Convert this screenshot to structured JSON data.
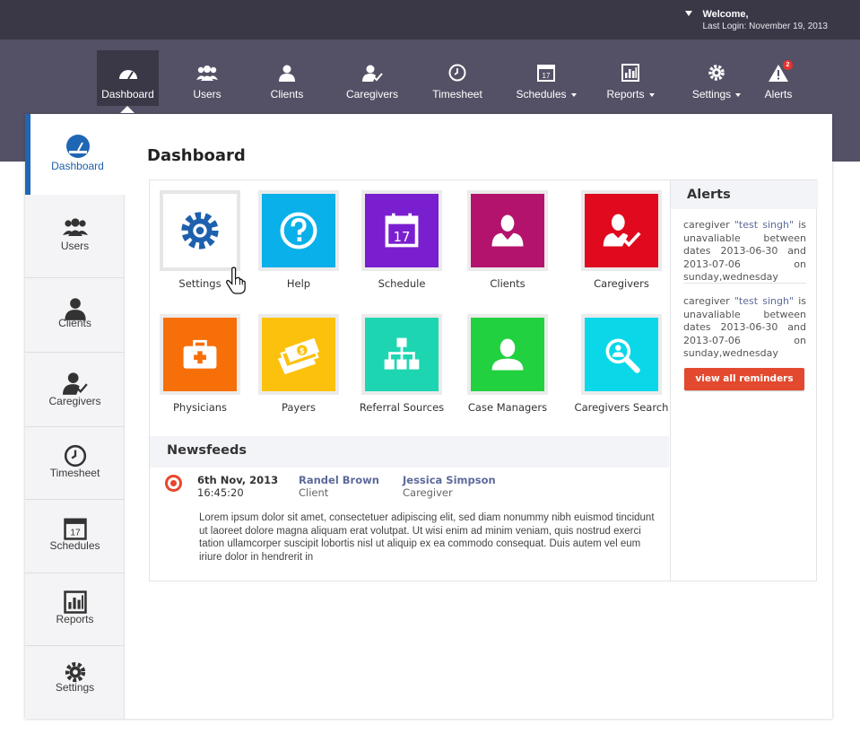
{
  "header": {
    "welcome": "Welcome,",
    "last_login": "Last Login: November 19, 2013"
  },
  "nav": {
    "items": [
      {
        "label": "Dashboard",
        "icon": "gauge-icon"
      },
      {
        "label": "Users",
        "icon": "users-icon"
      },
      {
        "label": "Clients",
        "icon": "client-icon"
      },
      {
        "label": "Caregivers",
        "icon": "caregiver-icon"
      },
      {
        "label": "Timesheet",
        "icon": "clock-icon"
      },
      {
        "label": "Schedules",
        "icon": "calendar-icon"
      },
      {
        "label": "Reports",
        "icon": "bar-chart-icon"
      },
      {
        "label": "Settings",
        "icon": "gear-icon"
      },
      {
        "label": "Alerts",
        "icon": "warning-icon"
      }
    ],
    "alerts_badge": "2"
  },
  "sidebar": {
    "items": [
      {
        "label": "Dashboard"
      },
      {
        "label": "Users"
      },
      {
        "label": "Clients"
      },
      {
        "label": "Caregivers"
      },
      {
        "label": "Timesheet"
      },
      {
        "label": "Schedules"
      },
      {
        "label": "Reports"
      },
      {
        "label": "Settings"
      }
    ]
  },
  "main": {
    "title": "Dashboard",
    "tiles": [
      {
        "label": "Settings",
        "color": "#ffffff"
      },
      {
        "label": "Help",
        "color": "#0ab0ea"
      },
      {
        "label": "Schedule",
        "color": "#7a1fd0"
      },
      {
        "label": "Clients",
        "color": "#b3136d"
      },
      {
        "label": "Caregivers",
        "color": "#e0091d"
      },
      {
        "label": "Physicians",
        "color": "#f76f08"
      },
      {
        "label": "Payers",
        "color": "#fcc10c"
      },
      {
        "label": "Referral Sources",
        "color": "#1dd6b1"
      },
      {
        "label": "Case Managers",
        "color": "#22d13f"
      },
      {
        "label": "Caregivers Search",
        "color": "#0ad8e9"
      }
    ]
  },
  "newsfeeds": {
    "title": "Newsfeeds",
    "entry": {
      "date": "6th Nov, 2013",
      "time": "16:45:20",
      "person1_name": "Randel Brown",
      "person1_role": "Client",
      "person2_name": "Jessica Simpson",
      "person2_role": "Caregiver",
      "body": "Lorem ipsum dolor sit amet, consectetuer adipiscing elit, sed diam nonummy nibh euismod tincidunt ut laoreet dolore magna aliquam erat volutpat. Ut wisi enim ad minim veniam, quis nostrud exerci tation ullamcorper suscipit lobortis nisl ut aliquip ex ea commodo consequat. Duis autem vel eum iriure dolor in hendrerit in"
    }
  },
  "alerts": {
    "title": "Alerts",
    "items": [
      {
        "pre": "caregiver ",
        "name": "\"test singh\"",
        "post": " is unavaliable between dates 2013-06-30 and 2013-07-06 on sunday,wednesday"
      },
      {
        "pre": "caregiver ",
        "name": "\"test singh\"",
        "post": " is unavaliable between dates 2013-06-30 and 2013-07-06 on sunday,wednesday"
      }
    ],
    "button": "view all reminders"
  }
}
